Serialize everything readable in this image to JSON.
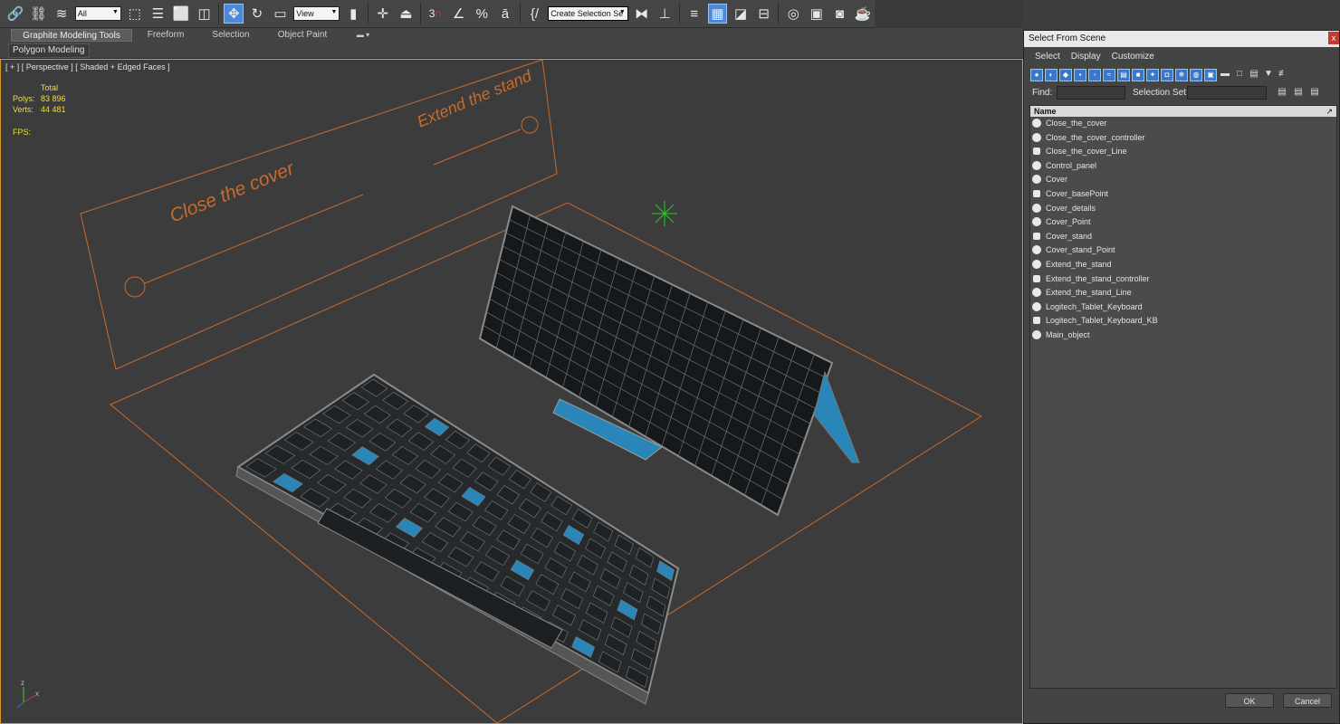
{
  "toolbar": {
    "filter_combo": "All",
    "refcoord_combo": "View",
    "selection_set_combo": "Create Selection Se",
    "snap_label": "3",
    "icons": [
      "link-icon",
      "unlink-icon",
      "bind-spacewarp-icon",
      "select-object-icon",
      "select-by-name-icon",
      "rect-selection-icon",
      "window-crossing-icon",
      "move-icon",
      "rotate-icon",
      "scale-icon",
      "use-pivot-icon",
      "pivot-center-icon",
      "select-manipulate-icon",
      "keyboard-shortcut-icon",
      "snaps-toggle-icon",
      "angle-snap-icon",
      "percent-snap-icon",
      "spinner-snap-icon",
      "edit-named-sets-icon",
      "mirror-icon",
      "align-icon",
      "layer-manager-icon",
      "graphite-toggle-icon",
      "curve-editor-icon",
      "schematic-view-icon",
      "material-editor-icon",
      "render-setup-icon",
      "rendered-frame-icon",
      "render-icon"
    ]
  },
  "ribbon": {
    "tabs": [
      "Graphite Modeling Tools",
      "Freeform",
      "Selection",
      "Object Paint"
    ],
    "sub_label": "Polygon Modeling"
  },
  "viewport": {
    "label": "[ + ] [ Perspective ] [ Shaded + Edged Faces ]",
    "stats": {
      "total_label": "Total",
      "polys_label": "Polys:",
      "polys_value": "83 896",
      "verts_label": "Verts:",
      "verts_value": "44 481",
      "fps_label": "FPS:"
    },
    "scene_text": {
      "close_cover": "Close the cover",
      "extend_stand": "Extend the stand"
    },
    "colors": {
      "helper": "#c86a2c",
      "wire": "#8c8c8c",
      "panel": "#171a1c",
      "accent": "#2a86b8"
    }
  },
  "dialog": {
    "title": "Select From Scene",
    "close": "x",
    "menu": [
      "Select",
      "Display",
      "Customize"
    ],
    "find_label": "Find:",
    "selection_set_label": "Selection Set:",
    "column_name": "Name",
    "items": [
      "Close_the_cover",
      "Close_the_cover_controller",
      "Close_the_cover_Line",
      "Control_panel",
      "Cover",
      "Cover_basePoint",
      "Cover_details",
      "Cover_Point",
      "Cover_stand",
      "Cover_stand_Point",
      "Extend_the_stand",
      "Extend_the_stand_controller",
      "Extend_the_stand_Line",
      "Logitech_Tablet_Keyboard",
      "Logitech_Tablet_Keyboard_KB",
      "Main_object"
    ],
    "ok": "OK",
    "cancel": "Cancel"
  }
}
